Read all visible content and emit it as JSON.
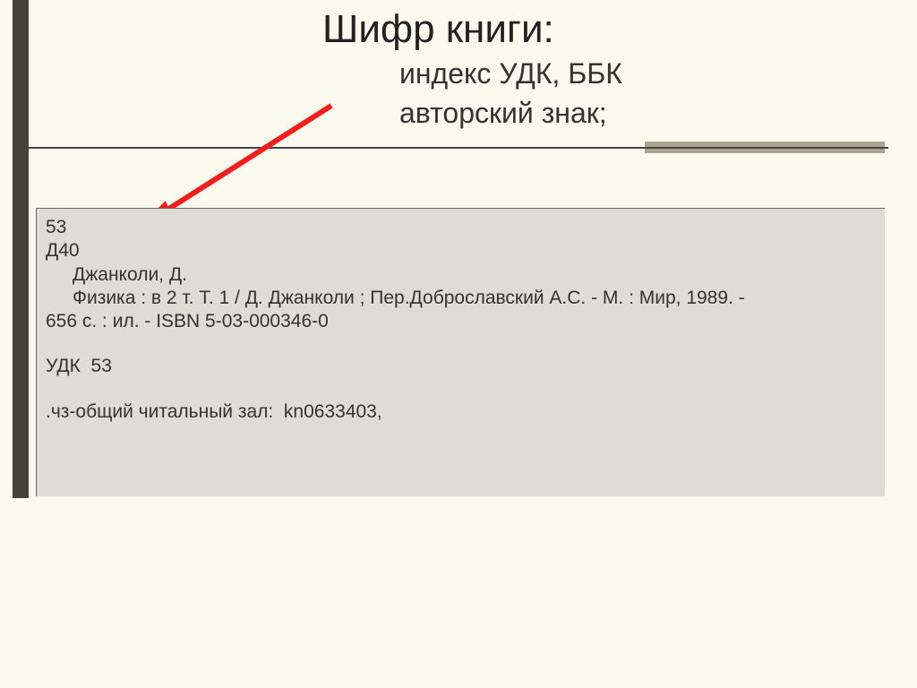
{
  "heading": {
    "title": "Шифр книги:",
    "sub1": "индекс УДК, ББК",
    "sub2": "авторский знак;"
  },
  "record": {
    "code1": "53",
    "code2": "Д40",
    "author": "Джанколи, Д.",
    "desc": "Физика : в 2 т. Т. 1 / Д. Джанколи ; Пер.Доброславский А.С. - М. : Мир, 1989. -",
    "desc2": "656 с. : ил. - ISBN 5-03-000346-0",
    "udk": "УДК  53",
    "location": ".чз-общий читальный зал:  kn0633403,"
  }
}
